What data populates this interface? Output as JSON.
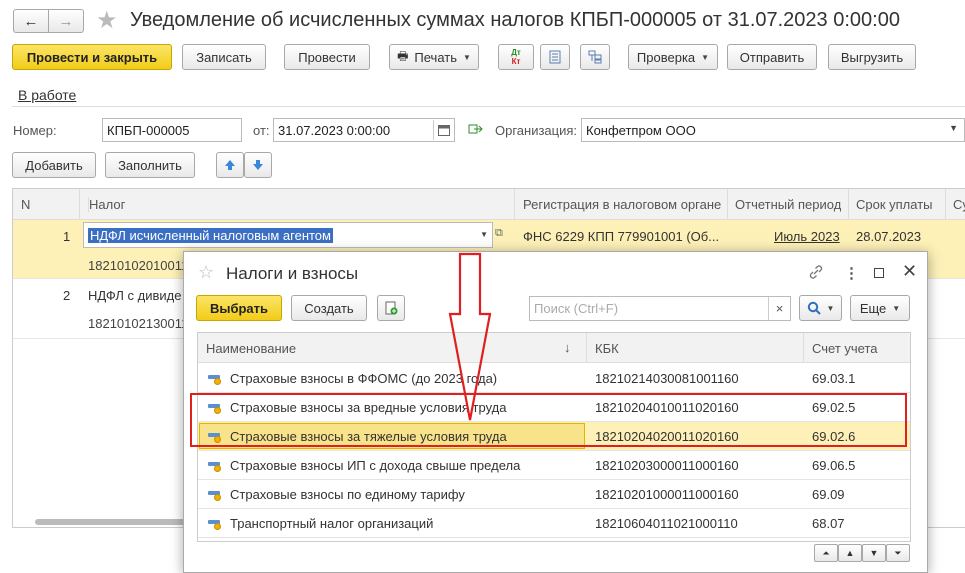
{
  "window": {
    "title": "Уведомление об исчисленных суммах налогов КПБП-000005 от 31.07.2023 0:00:00"
  },
  "toolbar": {
    "post_close": "Провести и закрыть",
    "save": "Записать",
    "post": "Провести",
    "print": "Печать",
    "dt_kt_top": "Дт",
    "dt_kt_bottom": "Кт",
    "check": "Проверка",
    "send": "Отправить",
    "export": "Выгрузить"
  },
  "status_link": "В работе",
  "form": {
    "number_label": "Номер:",
    "number_value": "КПБП-000005",
    "date_label": "от:",
    "date_value": "31.07.2023  0:00:00",
    "org_label": "Организация:",
    "org_value": "Конфетпром ООО"
  },
  "table_toolbar": {
    "add": "Добавить",
    "fill": "Заполнить"
  },
  "table": {
    "columns": [
      "N",
      "Налог",
      "Регистрация в налоговом органе",
      "Отчетный период",
      "Срок уплаты",
      "Су"
    ],
    "rows": [
      {
        "n": "1",
        "tax": "НДФЛ исчисленный налоговым агентом",
        "kbk": "18210102010011",
        "reg": "ФНС 6229 КПП 779901001 (Об...",
        "period": "Июль 2023",
        "due": "28.07.2023"
      },
      {
        "n": "2",
        "tax": "НДФЛ с дивиде",
        "kbk": "18210102130011",
        "reg": "",
        "period": "",
        "due": ""
      }
    ]
  },
  "popup": {
    "title": "Налоги и взносы",
    "select": "Выбрать",
    "create": "Создать",
    "search_placeholder": "Поиск (Ctrl+F)",
    "search_clear": "×",
    "more": "Еще",
    "columns": {
      "name": "Наименование",
      "sort": "↓",
      "kbk": "КБК",
      "account": "Счет учета"
    },
    "rows": [
      {
        "name": "Страховые взносы в ФФОМС (до 2023 года)",
        "kbk": "18210214030081001160",
        "account": "69.03.1"
      },
      {
        "name": "Страховые взносы за вредные условия труда",
        "kbk": "18210204010011020160",
        "account": "69.02.5"
      },
      {
        "name": "Страховые взносы за тяжелые условия труда",
        "kbk": "18210204020011020160",
        "account": "69.02.6"
      },
      {
        "name": "Страховые взносы ИП с дохода свыше предела",
        "kbk": "18210203000011000160",
        "account": "69.06.5"
      },
      {
        "name": "Страховые взносы по единому тарифу",
        "kbk": "18210201000011000160",
        "account": "69.09"
      },
      {
        "name": "Транспортный налог организаций",
        "kbk": "18210604011021000110",
        "account": "68.07"
      }
    ]
  },
  "colors": {
    "accent_yellow": "#f2cc19",
    "selection_blue": "#3b6fc4",
    "annotation_red": "#e02020",
    "row_highlight": "#fdf1b8"
  }
}
